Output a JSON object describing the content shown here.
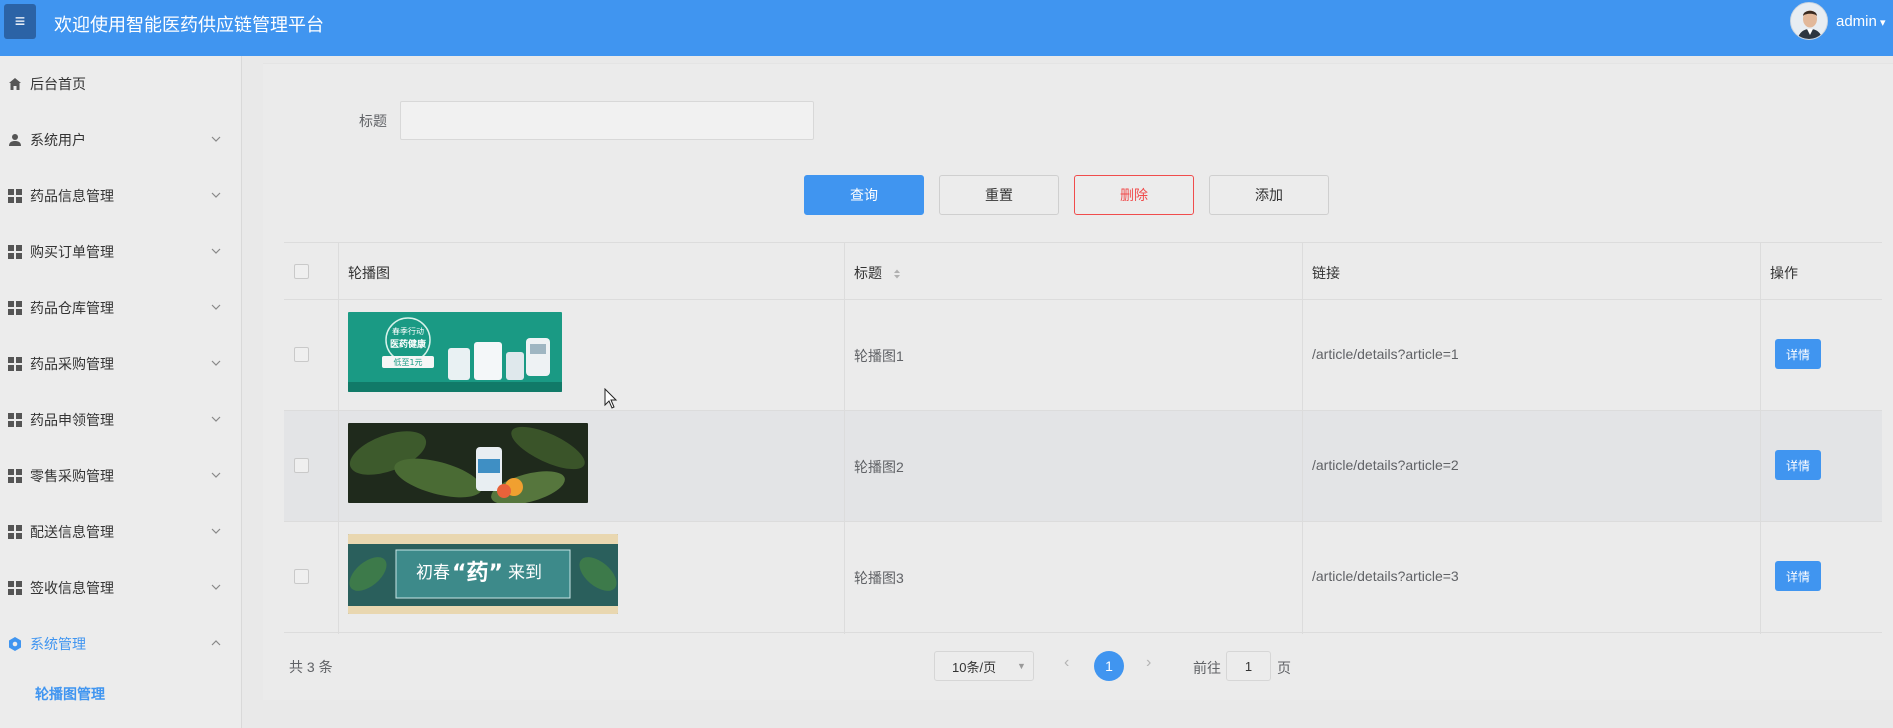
{
  "header": {
    "menu_toggle": "≡",
    "title": "欢迎使用智能医药供应链管理平台",
    "user_name": "admin",
    "user_caret": "▾"
  },
  "sidebar": {
    "items": [
      {
        "label": "后台首页",
        "icon": "home-icon"
      },
      {
        "label": "系统用户",
        "icon": "user-icon"
      },
      {
        "label": "药品信息管理",
        "icon": "grid-icon"
      },
      {
        "label": "购买订单管理",
        "icon": "grid-icon"
      },
      {
        "label": "药品仓库管理",
        "icon": "grid-icon"
      },
      {
        "label": "药品采购管理",
        "icon": "grid-icon"
      },
      {
        "label": "药品申领管理",
        "icon": "grid-icon"
      },
      {
        "label": "零售采购管理",
        "icon": "grid-icon"
      },
      {
        "label": "配送信息管理",
        "icon": "grid-icon"
      },
      {
        "label": "签收信息管理",
        "icon": "grid-icon"
      },
      {
        "label": "系统管理",
        "icon": "gear-icon"
      }
    ],
    "sub_item": "轮播图管理"
  },
  "filter": {
    "title_label": "标题",
    "title_value": "",
    "title_placeholder": ""
  },
  "actions": {
    "query": "查询",
    "reset": "重置",
    "delete": "删除",
    "add": "添加"
  },
  "table": {
    "headers": {
      "image": "轮播图",
      "title": "标题",
      "link": "链接",
      "ops": "操作"
    },
    "rows": [
      {
        "title": "轮播图1",
        "link": "/article/details?article=1",
        "action": "详情",
        "banner_text": [
          "春季行动",
          "医药健康",
          "低至1元"
        ]
      },
      {
        "title": "轮播图2",
        "link": "/article/details?article=2",
        "action": "详情",
        "banner_text": []
      },
      {
        "title": "轮播图3",
        "link": "/article/details?article=3",
        "action": "详情",
        "banner_text": [
          "初春",
          "“药”",
          "来到"
        ]
      }
    ]
  },
  "pagination": {
    "total": "共 3 条",
    "page_size": "10条/页",
    "current_page": "1",
    "goto_label": "前往",
    "goto_value": "1",
    "goto_suffix": "页",
    "prev": "‹",
    "next": "›"
  },
  "colors": {
    "accent": "#4095f0",
    "danger": "#f04c4c",
    "header_toggle_bg": "#2b63a6"
  }
}
